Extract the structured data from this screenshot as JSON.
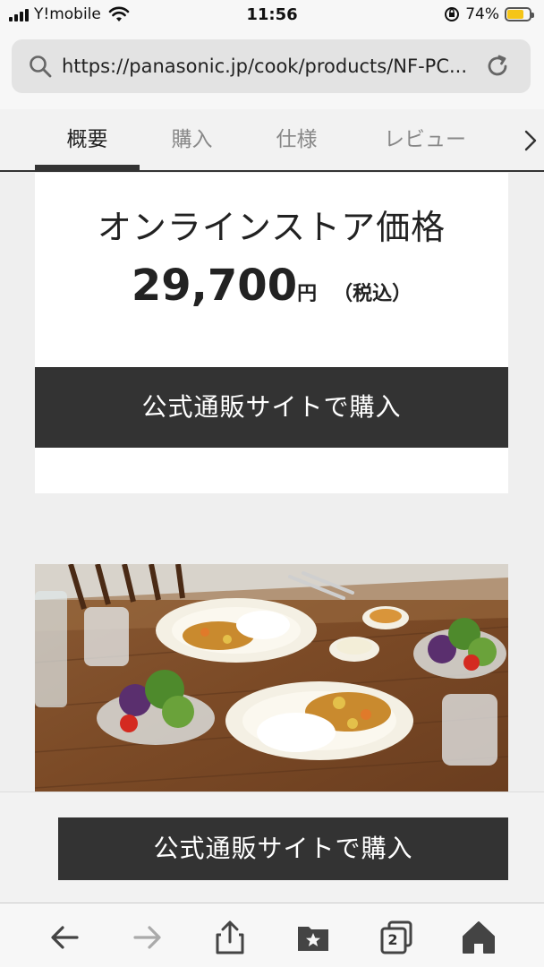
{
  "status_bar": {
    "carrier": "Y!mobile",
    "time": "11:56",
    "battery": "74%",
    "battery_level": 0.74,
    "battery_color": "#f5c518"
  },
  "browser": {
    "url": "https://panasonic.jp/cook/products/NF-PC...",
    "search_icon": "search-icon",
    "reload_icon": "reload-icon"
  },
  "tabs": [
    {
      "label": "概要",
      "active": true
    },
    {
      "label": "購入",
      "active": false
    },
    {
      "label": "仕様",
      "active": false
    },
    {
      "label": "レビュー",
      "active": false
    }
  ],
  "price_card": {
    "title": "オンラインストア価格",
    "amount": "29,700",
    "unit": "円",
    "tax_note": "（税込）",
    "button_label": "公式通販サイトで購入"
  },
  "sticky_bar": {
    "button_label": "公式通販サイトで購入"
  },
  "toolbar": {
    "tabs_count": "2",
    "icons": [
      "back-arrow-icon",
      "forward-arrow-icon",
      "share-icon",
      "bookmarks-icon",
      "tabs-icon",
      "home-icon"
    ]
  },
  "colors": {
    "button_bg": "#333333",
    "page_bg": "#efefef"
  }
}
